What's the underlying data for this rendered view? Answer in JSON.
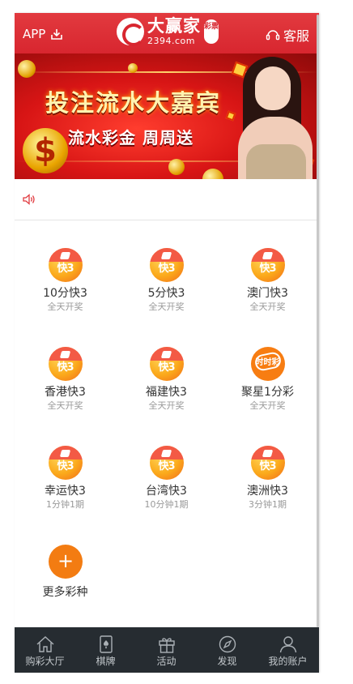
{
  "header": {
    "app_label": "APP",
    "app_icon": "download-icon",
    "logo_text": "大赢家",
    "logo_domain": "2394.com",
    "logo_seal": "彩票",
    "service_label": "客服",
    "service_icon": "headset-icon"
  },
  "banner": {
    "title": "投注流水大嘉宾",
    "subtitle": "流水彩金 周周送",
    "symbol": "$"
  },
  "notice": {
    "icon": "speaker-icon",
    "text": ""
  },
  "games": [
    {
      "name": "10分快3",
      "sub": "全天开奖",
      "badge": "快3",
      "style": "k3"
    },
    {
      "name": "5分快3",
      "sub": "全天开奖",
      "badge": "快3",
      "style": "k3"
    },
    {
      "name": "澳门快3",
      "sub": "全天开奖",
      "badge": "快3",
      "style": "k3"
    },
    {
      "name": "香港快3",
      "sub": "全天开奖",
      "badge": "快3",
      "style": "k3"
    },
    {
      "name": "福建快3",
      "sub": "全天开奖",
      "badge": "快3",
      "style": "k3"
    },
    {
      "name": "聚星1分彩",
      "sub": "全天开奖",
      "badge": "时时彩",
      "style": "ssc"
    },
    {
      "name": "幸运快3",
      "sub": "1分钟1期",
      "badge": "快3",
      "style": "k3"
    },
    {
      "name": "台湾快3",
      "sub": "10分钟1期",
      "badge": "快3",
      "style": "k3"
    },
    {
      "name": "澳洲快3",
      "sub": "3分钟1期",
      "badge": "快3",
      "style": "k3"
    }
  ],
  "more": {
    "label": "更多彩种",
    "symbol": "+"
  },
  "tabbar": [
    {
      "label": "购彩大厅",
      "icon": "home-icon"
    },
    {
      "label": "棋牌",
      "icon": "cards-icon"
    },
    {
      "label": "活动",
      "icon": "gift-icon"
    },
    {
      "label": "发现",
      "icon": "compass-icon"
    },
    {
      "label": "我的账户",
      "icon": "user-icon"
    }
  ],
  "colors": {
    "header_red": "#d8262f",
    "tabbar_bg": "#262c31",
    "badge_orange": "#f77d12",
    "notice_icon": "#e0393e"
  }
}
